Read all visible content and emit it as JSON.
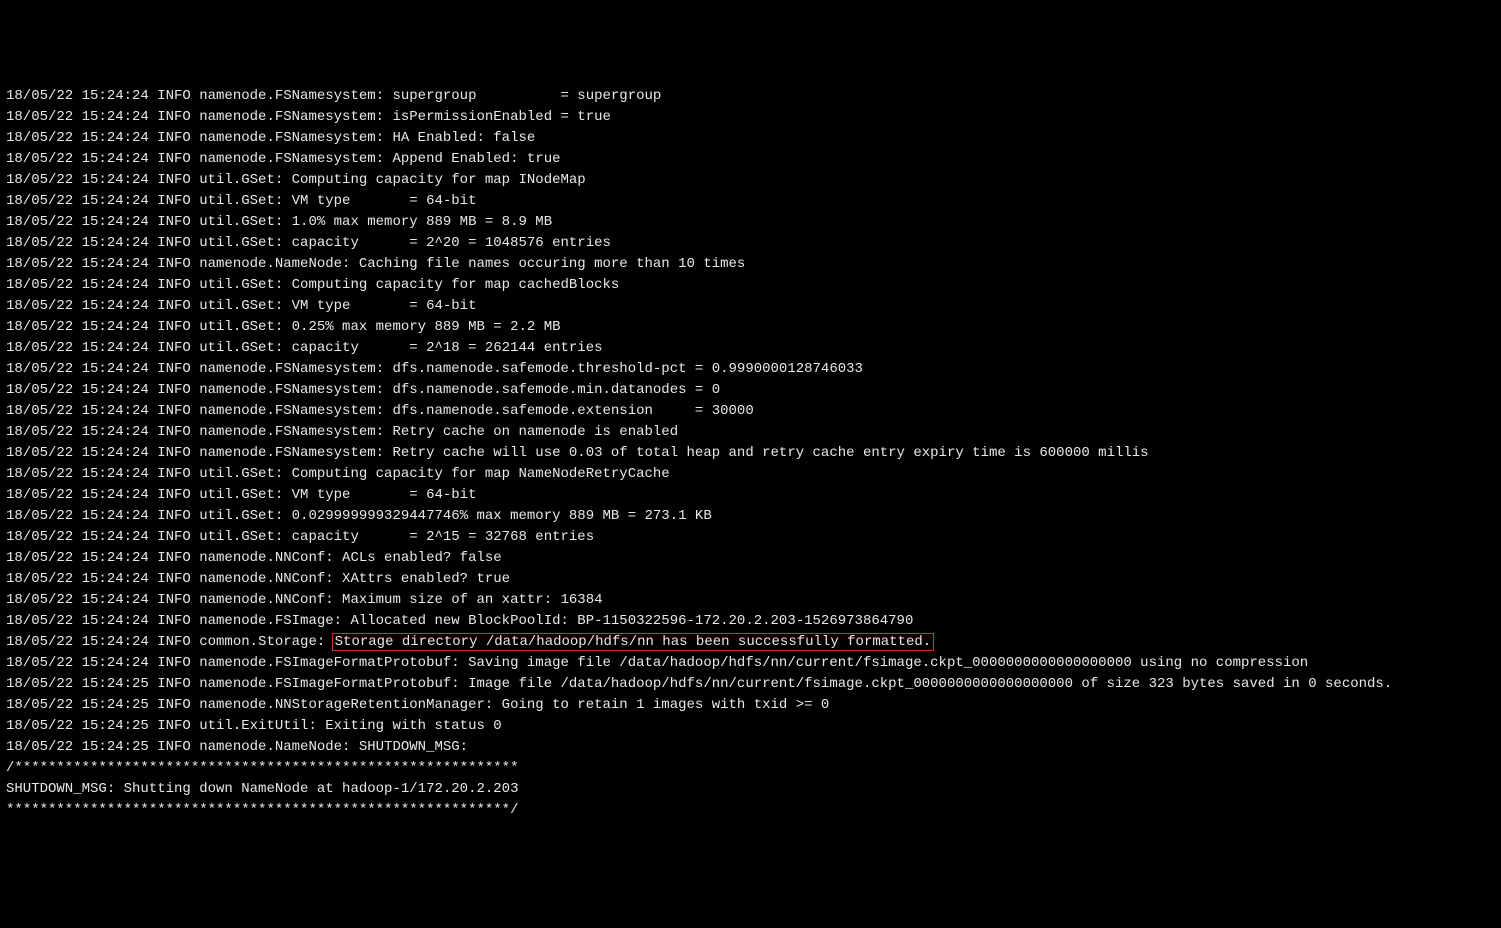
{
  "log": {
    "lines": [
      "18/05/22 15:24:24 INFO namenode.FSNamesystem: supergroup          = supergroup",
      "18/05/22 15:24:24 INFO namenode.FSNamesystem: isPermissionEnabled = true",
      "18/05/22 15:24:24 INFO namenode.FSNamesystem: HA Enabled: false",
      "18/05/22 15:24:24 INFO namenode.FSNamesystem: Append Enabled: true",
      "18/05/22 15:24:24 INFO util.GSet: Computing capacity for map INodeMap",
      "18/05/22 15:24:24 INFO util.GSet: VM type       = 64-bit",
      "18/05/22 15:24:24 INFO util.GSet: 1.0% max memory 889 MB = 8.9 MB",
      "18/05/22 15:24:24 INFO util.GSet: capacity      = 2^20 = 1048576 entries",
      "18/05/22 15:24:24 INFO namenode.NameNode: Caching file names occuring more than 10 times",
      "18/05/22 15:24:24 INFO util.GSet: Computing capacity for map cachedBlocks",
      "18/05/22 15:24:24 INFO util.GSet: VM type       = 64-bit",
      "18/05/22 15:24:24 INFO util.GSet: 0.25% max memory 889 MB = 2.2 MB",
      "18/05/22 15:24:24 INFO util.GSet: capacity      = 2^18 = 262144 entries",
      "18/05/22 15:24:24 INFO namenode.FSNamesystem: dfs.namenode.safemode.threshold-pct = 0.9990000128746033",
      "18/05/22 15:24:24 INFO namenode.FSNamesystem: dfs.namenode.safemode.min.datanodes = 0",
      "18/05/22 15:24:24 INFO namenode.FSNamesystem: dfs.namenode.safemode.extension     = 30000",
      "18/05/22 15:24:24 INFO namenode.FSNamesystem: Retry cache on namenode is enabled",
      "18/05/22 15:24:24 INFO namenode.FSNamesystem: Retry cache will use 0.03 of total heap and retry cache entry expiry time is 600000 millis",
      "18/05/22 15:24:24 INFO util.GSet: Computing capacity for map NameNodeRetryCache",
      "18/05/22 15:24:24 INFO util.GSet: VM type       = 64-bit",
      "18/05/22 15:24:24 INFO util.GSet: 0.029999999329447746% max memory 889 MB = 273.1 KB",
      "18/05/22 15:24:24 INFO util.GSet: capacity      = 2^15 = 32768 entries",
      "18/05/22 15:24:24 INFO namenode.NNConf: ACLs enabled? false",
      "18/05/22 15:24:24 INFO namenode.NNConf: XAttrs enabled? true",
      "18/05/22 15:24:24 INFO namenode.NNConf: Maximum size of an xattr: 16384",
      "18/05/22 15:24:24 INFO namenode.FSImage: Allocated new BlockPoolId: BP-1150322596-172.20.2.203-1526973864790"
    ],
    "highlight_prefix": "18/05/22 15:24:24 INFO common.Storage: ",
    "highlight_text": "Storage directory /data/hadoop/hdfs/nn has been successfully formatted.",
    "lines_after": [
      "18/05/22 15:24:24 INFO namenode.FSImageFormatProtobuf: Saving image file /data/hadoop/hdfs/nn/current/fsimage.ckpt_0000000000000000000 using no compression",
      "18/05/22 15:24:25 INFO namenode.FSImageFormatProtobuf: Image file /data/hadoop/hdfs/nn/current/fsimage.ckpt_0000000000000000000 of size 323 bytes saved in 0 seconds.",
      "18/05/22 15:24:25 INFO namenode.NNStorageRetentionManager: Going to retain 1 images with txid >= 0",
      "18/05/22 15:24:25 INFO util.ExitUtil: Exiting with status 0",
      "18/05/22 15:24:25 INFO namenode.NameNode: SHUTDOWN_MSG:",
      "/************************************************************",
      "SHUTDOWN_MSG: Shutting down NameNode at hadoop-1/172.20.2.203",
      "************************************************************/"
    ]
  }
}
